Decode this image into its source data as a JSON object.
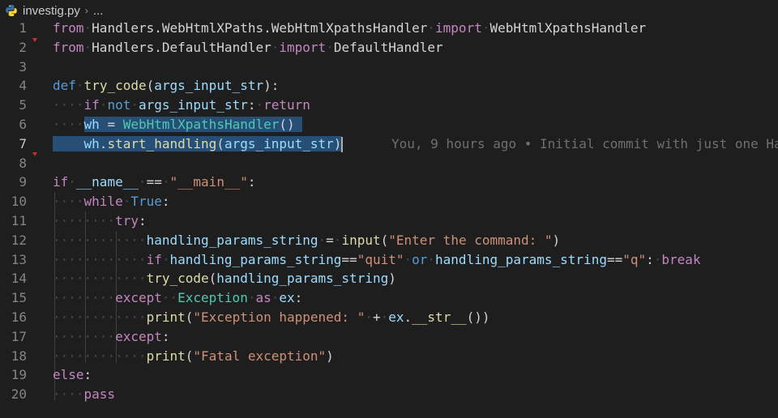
{
  "breadcrumb": {
    "file_name": "investig.py",
    "separator": "›",
    "more": "..."
  },
  "editor": {
    "line_numbers": [
      "1",
      "2",
      "3",
      "4",
      "5",
      "6",
      "7",
      "8",
      "9",
      "10",
      "11",
      "12",
      "13",
      "14",
      "15",
      "16",
      "17",
      "18",
      "19",
      "20"
    ],
    "active_line": "7",
    "blame_text": "You, 9 hours ago • Initial commit with just one Ha"
  },
  "colors": {
    "background": "#1e1e1e",
    "keyword": "#569cd6",
    "control": "#c586c0",
    "function": "#dcdcaa",
    "class": "#4ec9b0",
    "string": "#ce9178",
    "selection": "#264f78",
    "python_icon_blue": "#3572a5",
    "python_icon_yellow": "#ffd43b"
  },
  "code": {
    "l1": {
      "from": "from",
      "mod": "Handlers.WebHtmlXPaths.WebHtmlXpathsHandler",
      "import": "import",
      "name": "WebHtmlXpathsHandler"
    },
    "l2": {
      "from": "from",
      "mod": "Handlers.DefaultHandler",
      "import": "import",
      "name": "DefaultHandler"
    },
    "l4": {
      "def": "def",
      "fn": "try_code",
      "open": "(",
      "param": "args_input_str",
      "close": "):"
    },
    "l5": {
      "if": "if",
      "not": "not",
      "param": "args_input_str",
      "colon": ":",
      "ret": "return"
    },
    "l6": {
      "var": "wh",
      "eq": "=",
      "cls": "WebHtmlXpathsHandler",
      "call": "()"
    },
    "l7": {
      "var": "wh",
      "dot": ".",
      "method": "start_handling",
      "open": "(",
      "param": "args_input_str",
      "close": ")"
    },
    "l9": {
      "if": "if",
      "name": "__name__",
      "eq": "==",
      "str": "\"__main__\"",
      "colon": ":"
    },
    "l10": {
      "while": "while",
      "true": "True",
      "colon": ":"
    },
    "l11": {
      "try": "try",
      "colon": ":"
    },
    "l12": {
      "var": "handling_params_string",
      "eq": "=",
      "fn": "input",
      "open": "(",
      "str": "\"Enter the command: \"",
      "close": ")"
    },
    "l13": {
      "if": "if",
      "var": "handling_params_string",
      "eq": "==",
      "str1": "\"quit\"",
      "or": "or",
      "var2": "handling_params_string",
      "eq2": "==",
      "str2": "\"q\"",
      "colon": ":",
      "brk": "break"
    },
    "l14": {
      "fn": "try_code",
      "open": "(",
      "var": "handling_params_string",
      "close": ")"
    },
    "l15": {
      "except": "except",
      "cls": "Exception",
      "as": "as",
      "var": "ex",
      "colon": ":"
    },
    "l16": {
      "fn": "print",
      "open": "(",
      "str": "\"Exception happened: \"",
      "plus": "+",
      "var": "ex",
      "dot": ".",
      "method": "__str__",
      "close": "())"
    },
    "l17": {
      "except": "except",
      "colon": ":"
    },
    "l18": {
      "fn": "print",
      "open": "(",
      "str": "\"Fatal exception\"",
      "close": ")"
    },
    "l19": {
      "else": "else",
      "colon": ":"
    },
    "l20": {
      "pass": "pass"
    }
  }
}
